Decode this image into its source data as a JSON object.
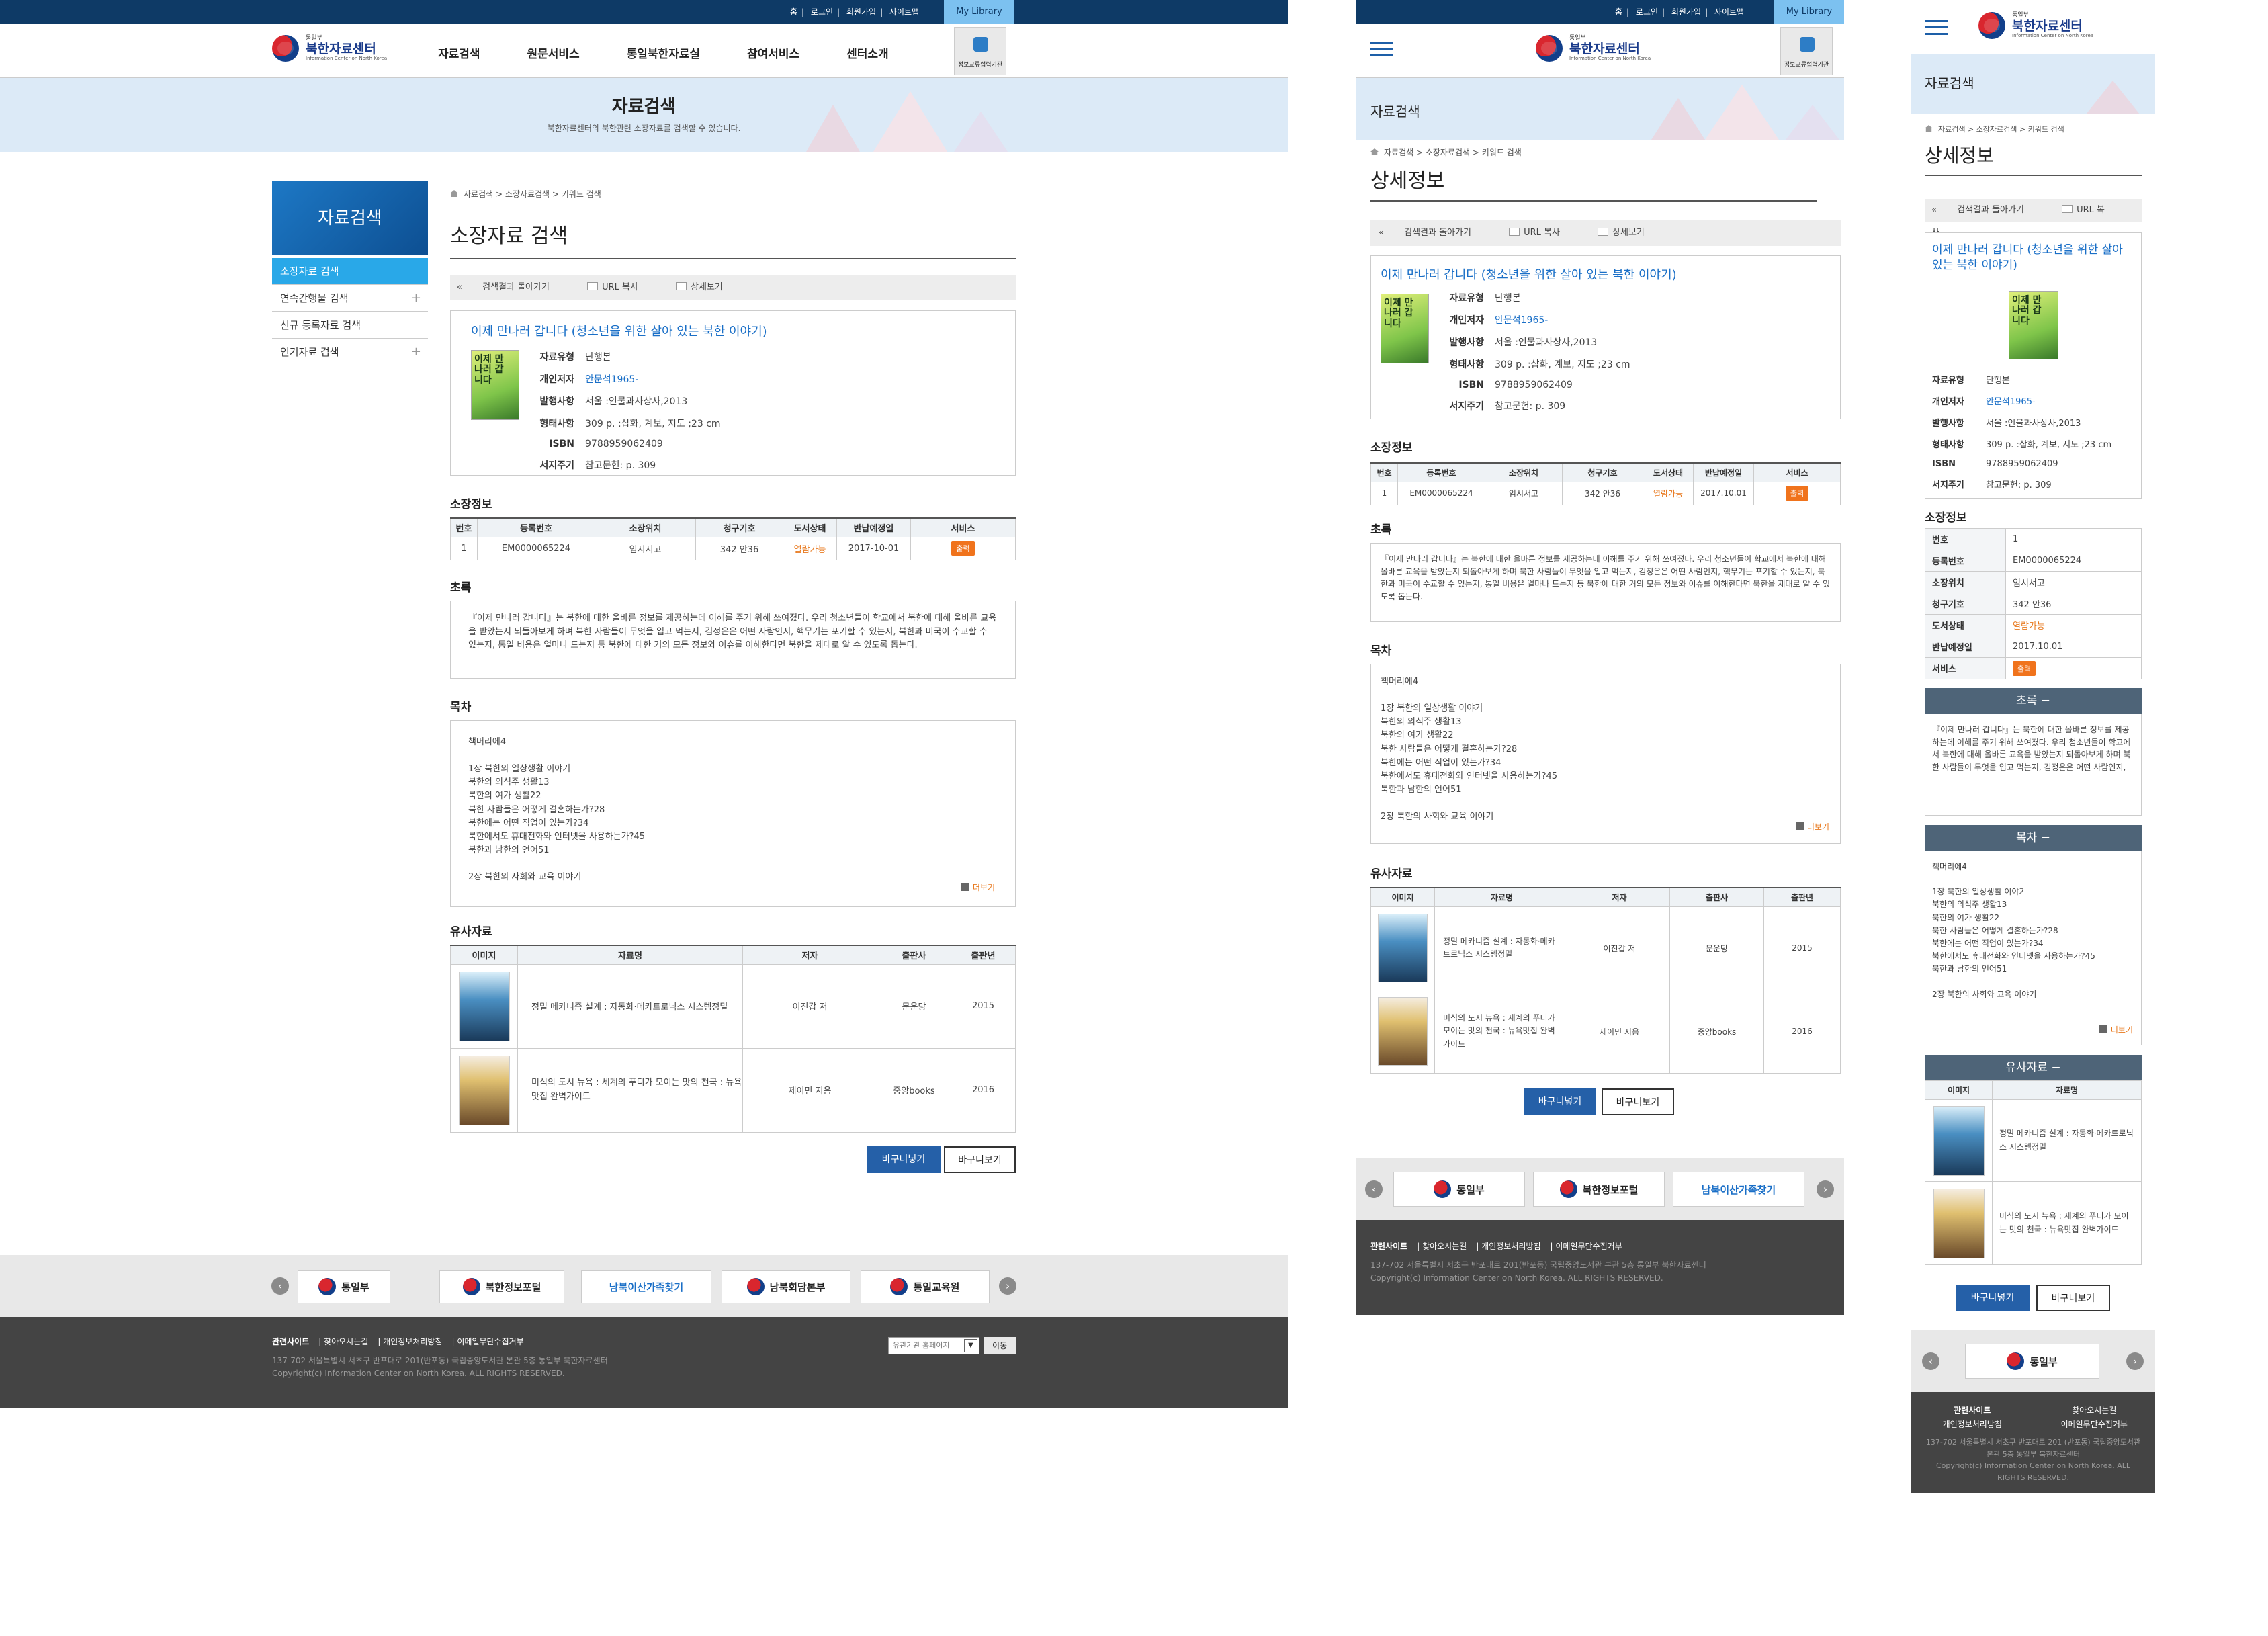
{
  "site": {
    "logo_sup": "통일부",
    "logo_main": "북한자료센터",
    "logo_sub": "Information Center on North Korea",
    "top_links": [
      "홈",
      "로그인",
      "회원가입",
      "사이트맵"
    ],
    "my_library": "My Library",
    "gnb": [
      "자료검색",
      "원문서비스",
      "통일북한자료실",
      "참여서비스",
      "센터소개"
    ],
    "edu_badge": "정보교류협력기관"
  },
  "banner": {
    "title": "자료검색",
    "subtitle": "북한자료센터의 북한관련 소장자료를 검색할 수 있습니다."
  },
  "lnb": {
    "title": "자료검색",
    "items": [
      {
        "label": "소장자료 검색",
        "active": true
      },
      {
        "label": "연속간행물 검색",
        "expand": "+"
      },
      {
        "label": "신규 등록자료 검색"
      },
      {
        "label": "인기자료 검색",
        "expand": "+"
      }
    ]
  },
  "breadcrumb": "자료검색 > 소장자료검색 > 키워드 검색",
  "page_title_desktop": "소장자료 검색",
  "page_title_mobile": "상세정보",
  "toolbar": {
    "back": "검색결과 돌아가기",
    "url_copy": "URL 복사",
    "detail": "상세보기"
  },
  "book": {
    "title": "이제 만나러 갑니다 (청소년을 위한 살아 있는 북한 이야기)",
    "fields": [
      {
        "k": "자료유형",
        "v": "단행본"
      },
      {
        "k": "개인저자",
        "v": "안문석1965-",
        "link": true
      },
      {
        "k": "발행사항",
        "v": "서울 :인물과사상사,2013"
      },
      {
        "k": "형태사항",
        "v": "309 p. :삽화, 계보, 지도 ;23 cm"
      },
      {
        "k": "ISBN",
        "v": "9788959062409"
      },
      {
        "k": "서지주기",
        "v": "참고문헌: p. 309"
      }
    ]
  },
  "holdings": {
    "heading": "소장정보",
    "headers": [
      "번호",
      "등록번호",
      "소장위치",
      "청구기호",
      "도서상태",
      "반납예정일",
      "서비스"
    ],
    "row": [
      "1",
      "EM0000065224",
      "임시서고",
      "342 안36",
      "열람가능",
      "2017-10-01",
      "출력"
    ],
    "mobile_due": "2017.10.01"
  },
  "abstract": {
    "heading": "초록",
    "text": "『이제 만나러 갑니다』는 북한에 대한 올바른 정보를 제공하는데 이해를 주기 위해 쓰여졌다. 우리 청소년들이 학교에서 북한에 대해 올바른 교육을 받았는지 되돌아보게 하며 북한 사람들이 무엇을 입고 먹는지, 김정은은 어떤 사람인지, 핵무기는 포기할 수 있는지, 북한과 미국이 수교할 수 있는지, 통일 비용은 얼마나 드는지 등 북한에 대한 거의 모든 정보와 이슈를 이해한다면 북한을 제대로 알 수 있도록 돕는다.",
    "text_mobile": "『이제 만나러 갑니다』는 북한에 대한 올바른 정보를 제공하는데 이해를 주기 위해 쓰여졌다. 우리 청소년들이 학교에서 북한에 대해 올바른 교육을 받았는지 되돌아보게 하며 북한 사람들이 무엇을 입고 먹는지, 김정은은 어떤 사람인지,"
  },
  "toc": {
    "heading": "목차",
    "lines": [
      "책머리에4",
      "",
      "1장 북한의 일상생활 이야기",
      "북한의 의식주 생활13",
      "북한의 여가 생활22",
      "북한 사람들은 어떻게 결혼하는가?28",
      "북한에는 어떤 직업이 있는가?34",
      "북한에서도 휴대전화와 인터넷을 사용하는가?45",
      "북한과 남한의 언어51",
      "",
      "2장 북한의 사회와 교육 이야기"
    ],
    "more": "더보기"
  },
  "similar": {
    "heading": "유사자료",
    "headers": [
      "이미지",
      "자료명",
      "저자",
      "출판사",
      "출판년"
    ],
    "rows": [
      {
        "title": "정밀 메카니즘 설계 : 자동화·메카트로닉스 시스템정밀",
        "author": "이진갑 저",
        "pub": "문운당",
        "year": "2015"
      },
      {
        "title": "미식의 도시 뉴욕 : 세계의 푸디가 모이는 맛의 천국 : 뉴욕맛집 완벽가이드",
        "author": "제이민 지음",
        "pub": "중앙books",
        "year": "2016"
      }
    ]
  },
  "buttons": {
    "cart_add": "바구니넣기",
    "cart_view": "바구니보기"
  },
  "footer_banners": [
    "통일부",
    "북한정보포털",
    "남북이산가족찾기",
    "남북회담본부",
    "통일교육원"
  ],
  "footer": {
    "links": [
      "관련사이트",
      "찾아오시는길",
      "개인정보처리방침",
      "이메일무단수집거부"
    ],
    "address": "137-702 서울특별시 서초구 반포대로 201(반포동) 국립중앙도서관 본관 5층 통일부 북한자료센터",
    "copyright": "Copyright(c) Information Center on North Korea. ALL RIGHTS RESERVED.",
    "select_placeholder": "유관기관 홈페이지",
    "go": "이동"
  },
  "mobile_footer": {
    "address": "137-702 서울특별시 서초구 반포대로 201 (반포동) 국립중앙도서관 본관 5층 통일부 북한자료센터",
    "copyright": "Copyright(c) Information Center on North Korea. ALL RIGHTS RESERVED."
  }
}
